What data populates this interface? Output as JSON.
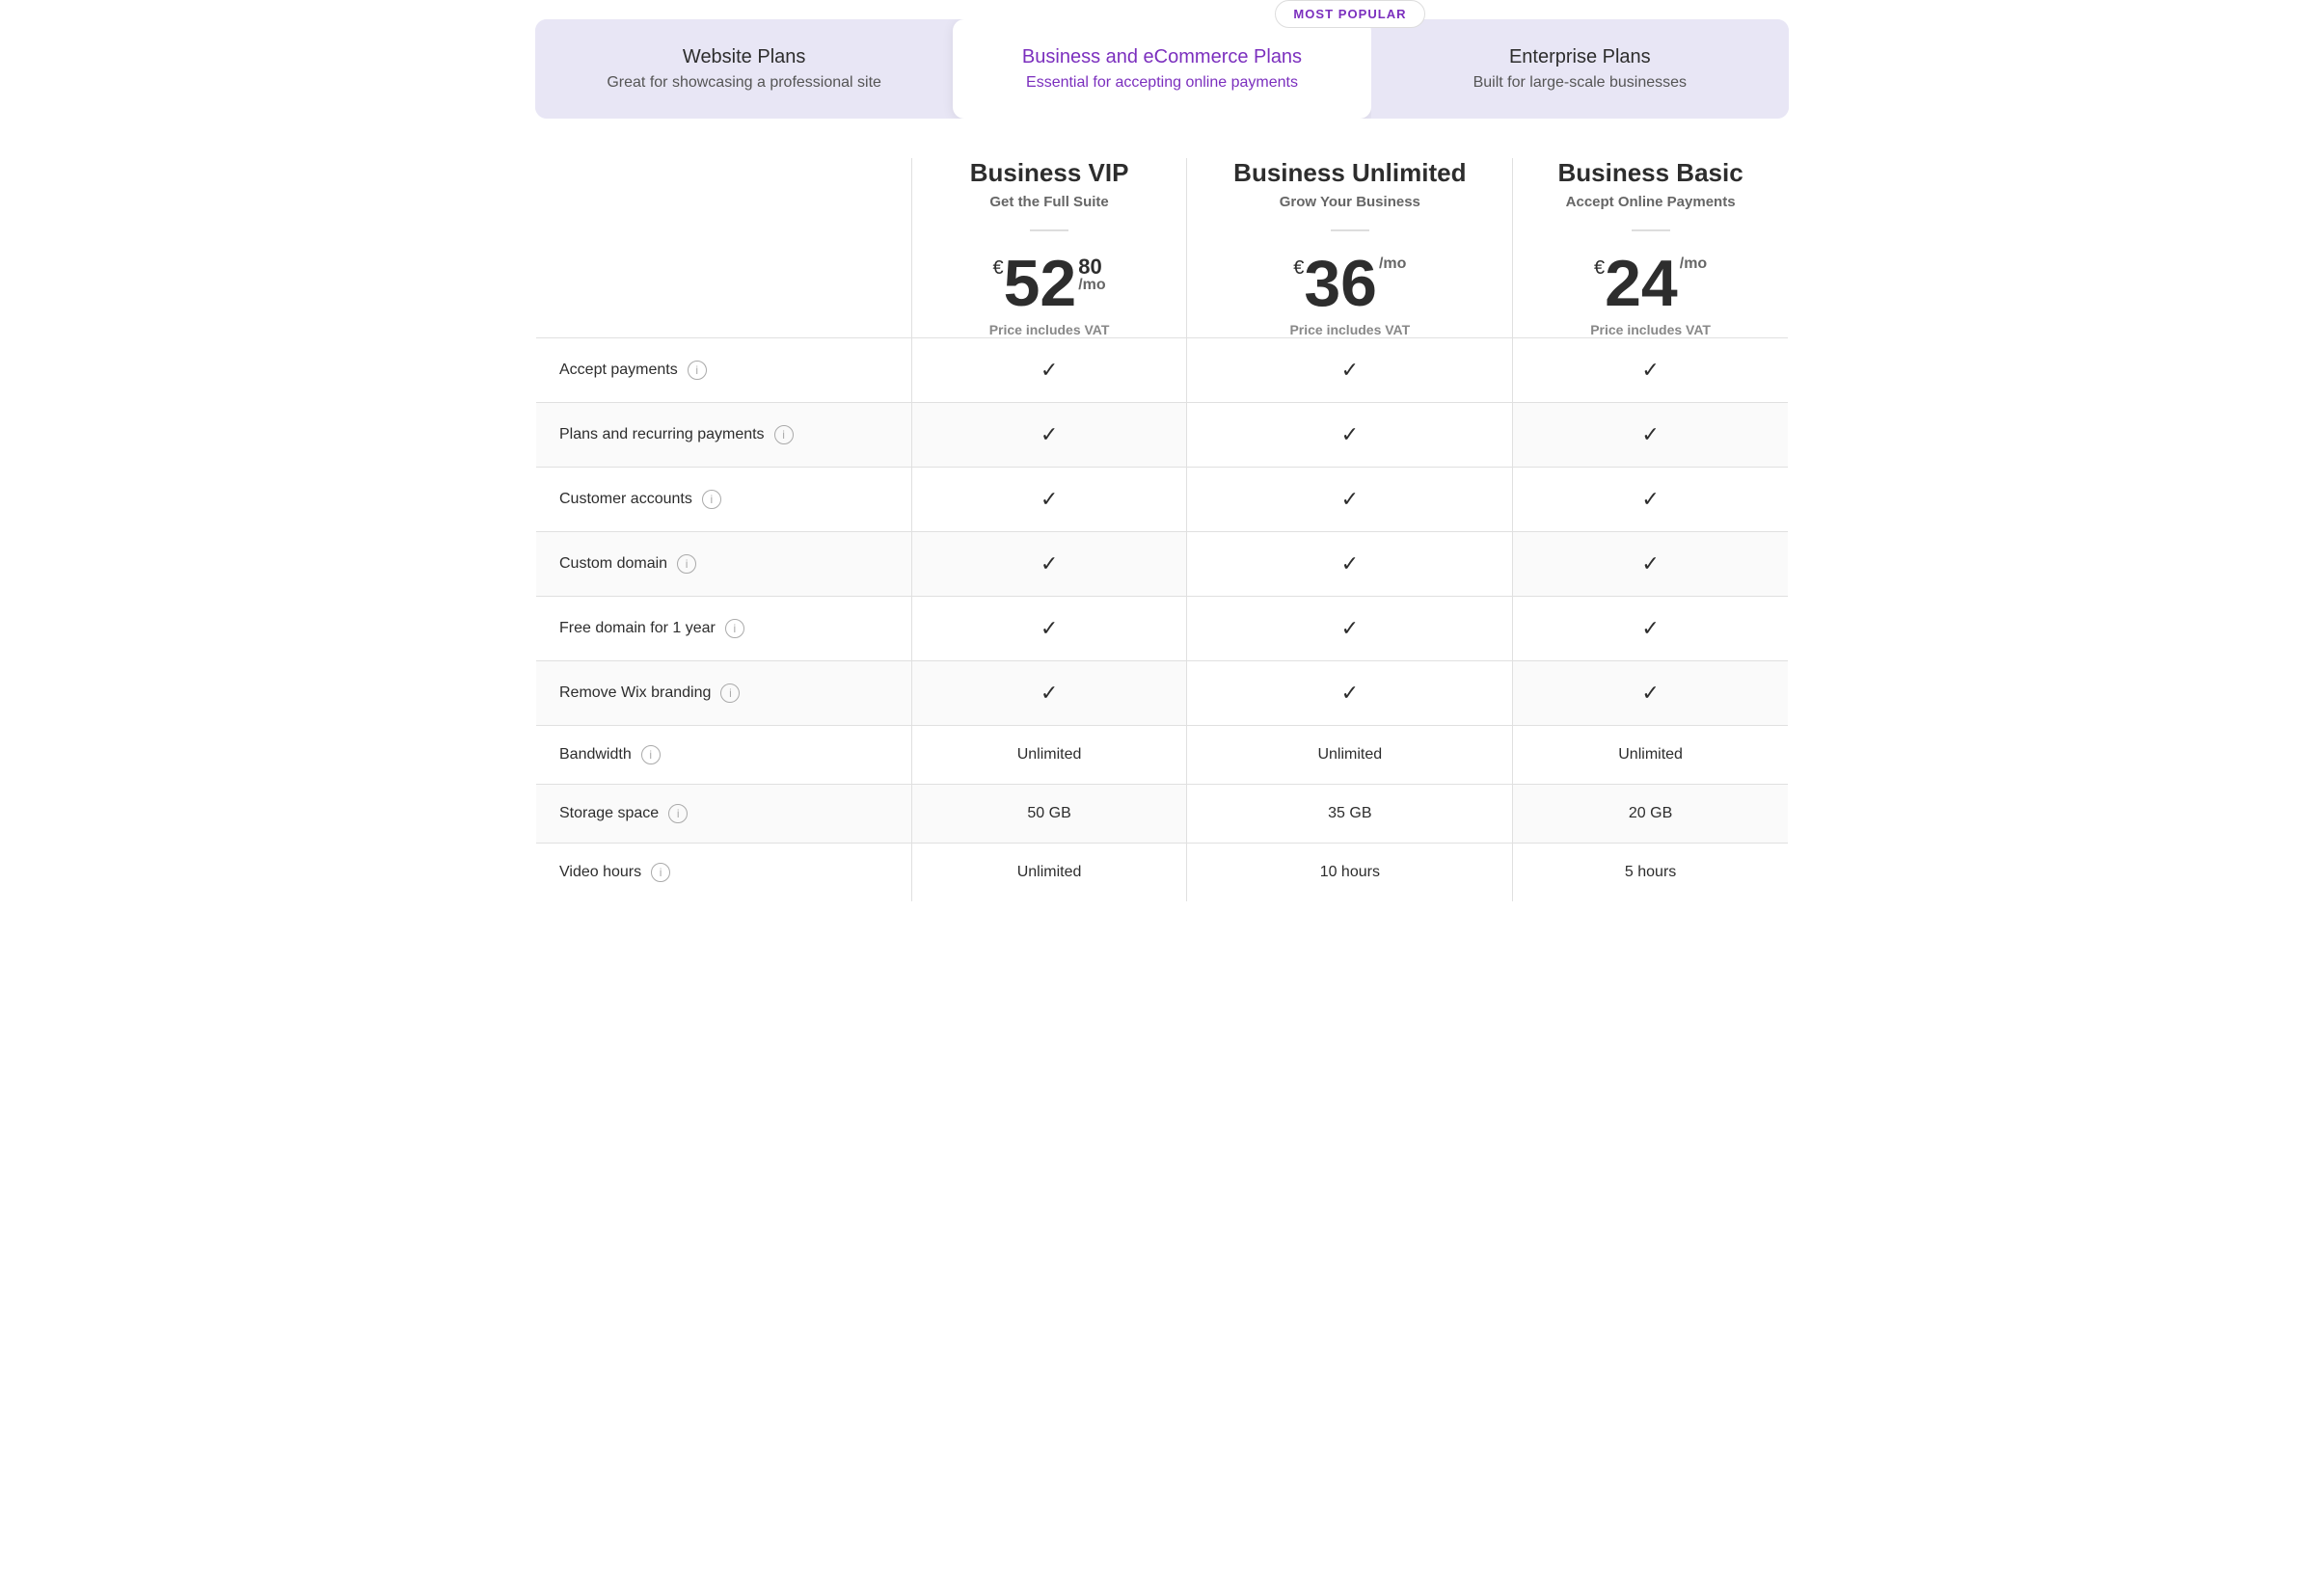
{
  "tabs": [
    {
      "id": "website",
      "title": "Website Plans",
      "subtitle": "Great for showcasing a professional site",
      "active": false
    },
    {
      "id": "business",
      "title": "Business and eCommerce Plans",
      "subtitle": "Essential for accepting online payments",
      "active": true
    },
    {
      "id": "enterprise",
      "title": "Enterprise Plans",
      "subtitle": "Built for large-scale businesses",
      "active": false
    }
  ],
  "most_popular_label": "MOST POPULAR",
  "plans": [
    {
      "id": "vip",
      "name": "Business VIP",
      "tagline": "Get the Full Suite",
      "currency": "€",
      "price_whole": "52",
      "price_cents": "80",
      "price_mo": "/mo",
      "vat_text": "Price includes VAT"
    },
    {
      "id": "unlimited",
      "name": "Business Unlimited",
      "tagline": "Grow Your Business",
      "currency": "€",
      "price_whole": "36",
      "price_cents": "",
      "price_mo": "/mo",
      "vat_text": "Price includes VAT",
      "popular": true
    },
    {
      "id": "basic",
      "name": "Business Basic",
      "tagline": "Accept Online Payments",
      "currency": "€",
      "price_whole": "24",
      "price_cents": "",
      "price_mo": "/mo",
      "vat_text": "Price includes VAT"
    }
  ],
  "features": [
    {
      "label": "Accept payments",
      "vip": "check",
      "unlimited": "check",
      "basic": "check"
    },
    {
      "label": "Plans and recurring payments",
      "vip": "check",
      "unlimited": "check",
      "basic": "check"
    },
    {
      "label": "Customer accounts",
      "vip": "check",
      "unlimited": "check",
      "basic": "check"
    },
    {
      "label": "Custom domain",
      "vip": "check",
      "unlimited": "check",
      "basic": "check"
    },
    {
      "label": "Free domain for 1 year",
      "vip": "check",
      "unlimited": "check",
      "basic": "check"
    },
    {
      "label": "Remove Wix branding",
      "vip": "check",
      "unlimited": "check",
      "basic": "check"
    },
    {
      "label": "Bandwidth",
      "vip": "Unlimited",
      "unlimited": "Unlimited",
      "basic": "Unlimited"
    },
    {
      "label": "Storage space",
      "vip": "50 GB",
      "unlimited": "35 GB",
      "basic": "20 GB"
    },
    {
      "label": "Video hours",
      "vip": "Unlimited",
      "unlimited": "10 hours",
      "basic": "5 hours"
    }
  ],
  "check_symbol": "✓",
  "info_symbol": "i"
}
